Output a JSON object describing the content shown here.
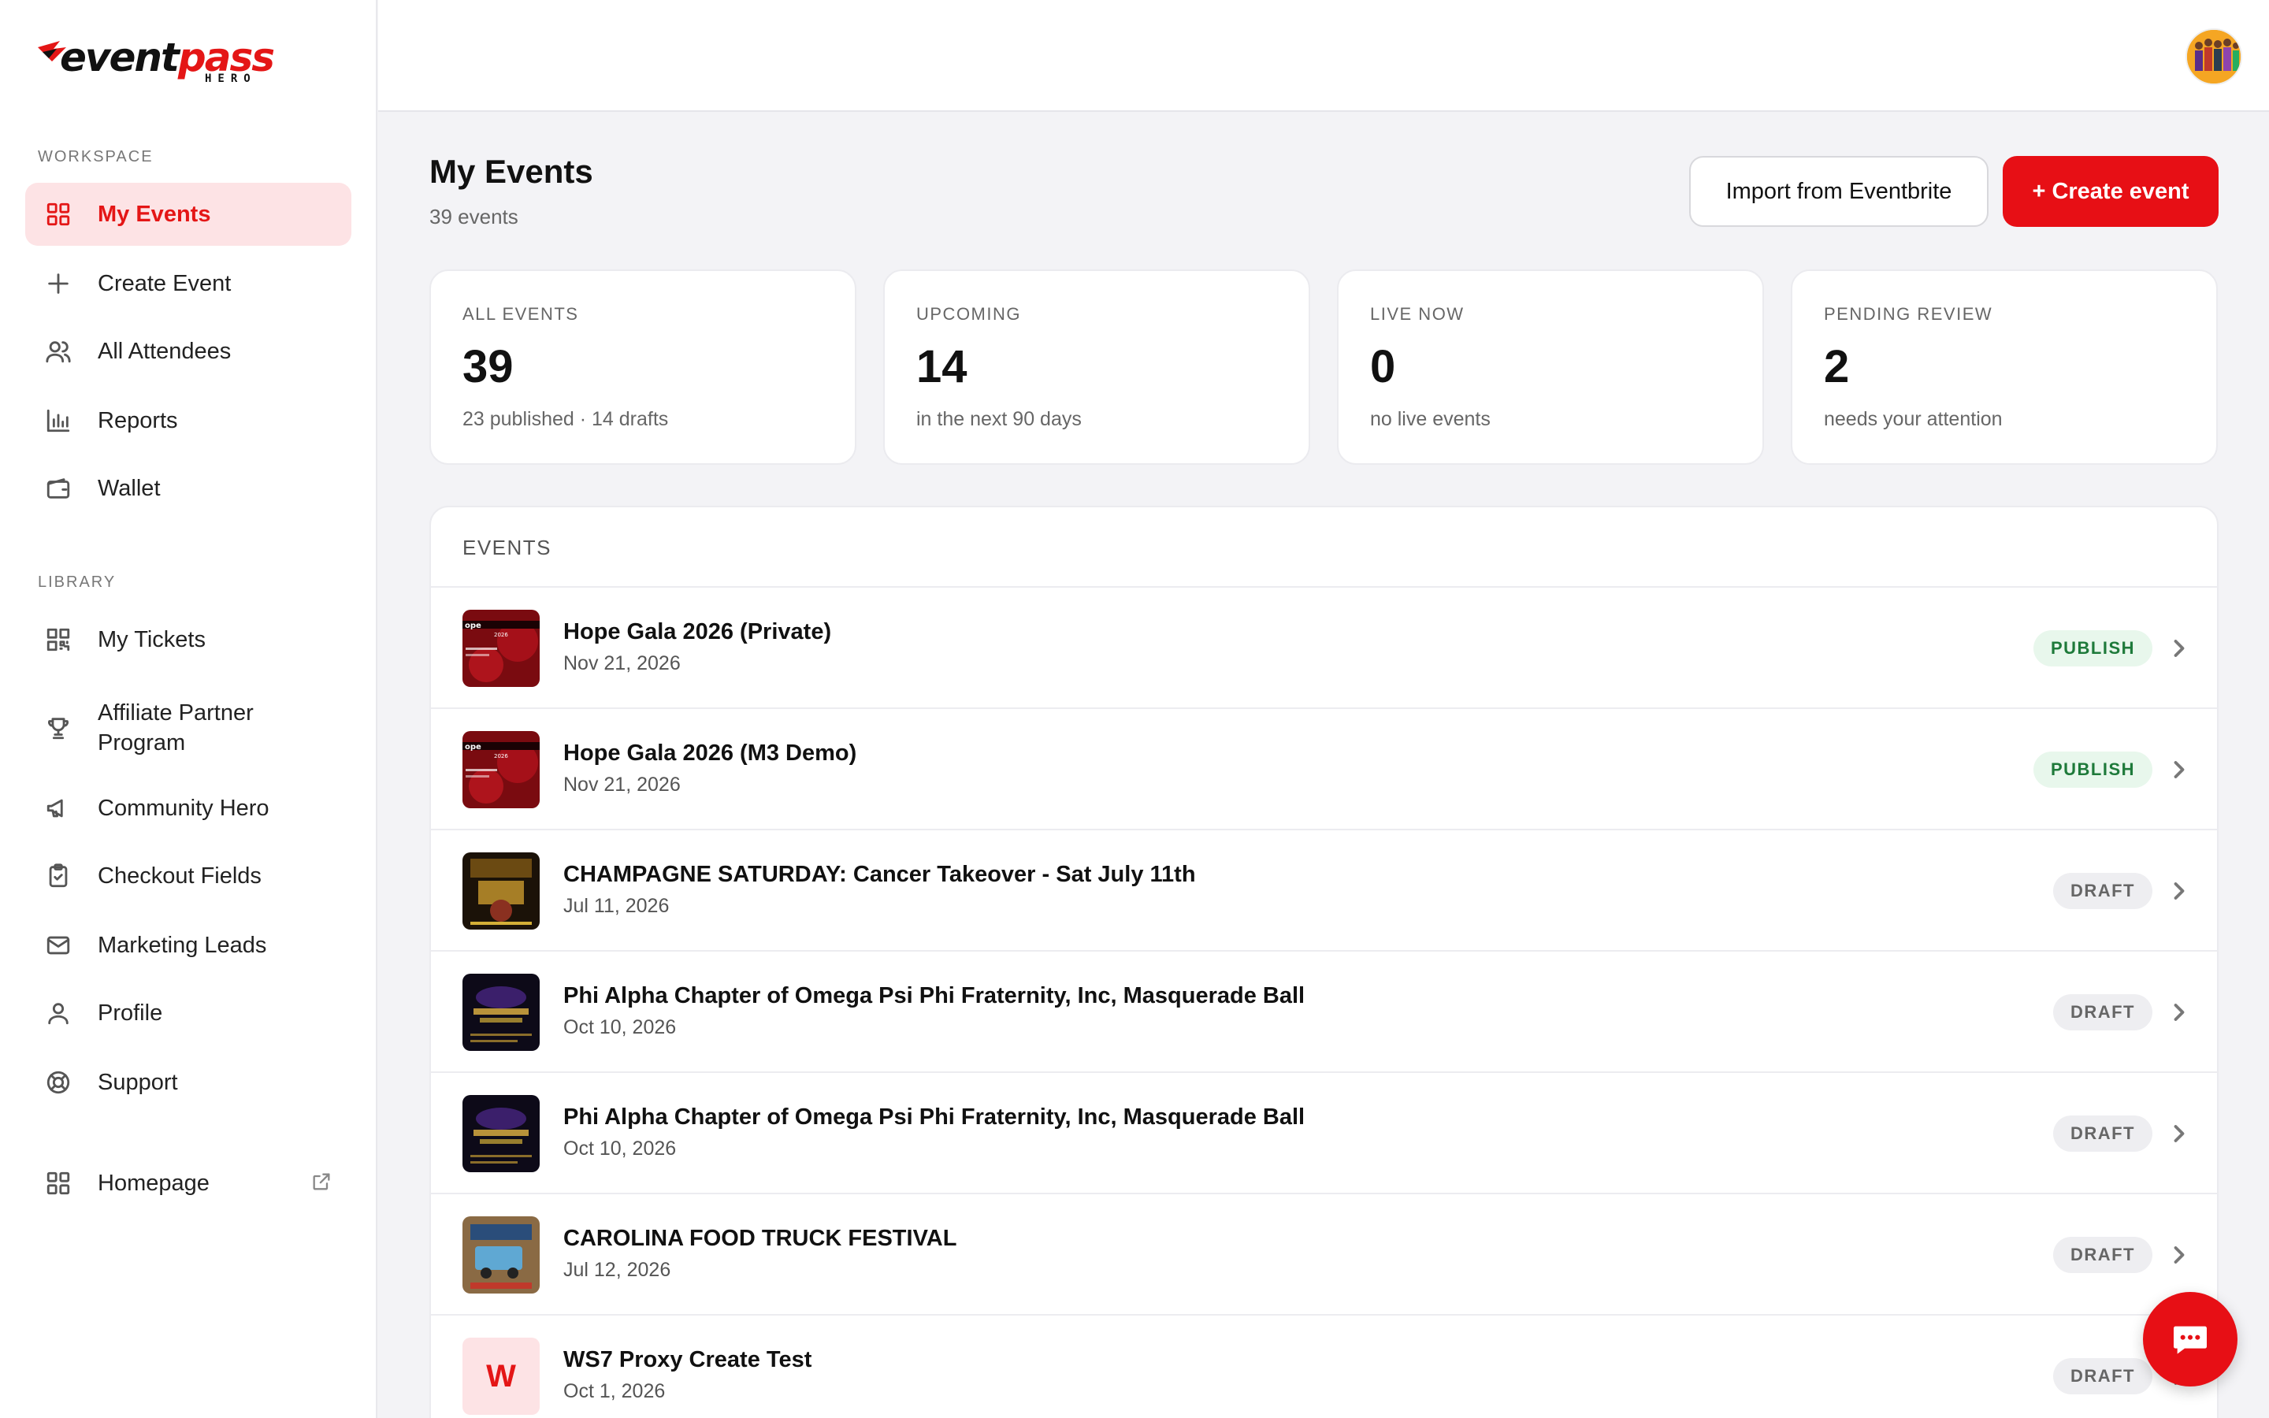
{
  "brand": {
    "name_part1": "event",
    "name_part2": "pass",
    "sub": "HERO",
    "accent": "#e70f15"
  },
  "sidebar": {
    "workspace_label": "WORKSPACE",
    "library_label": "LIBRARY",
    "workspace_items": [
      {
        "label": "My Events",
        "icon": "grid-icon",
        "active": true
      },
      {
        "label": "Create Event",
        "icon": "plus-icon"
      },
      {
        "label": "All Attendees",
        "icon": "users-icon"
      },
      {
        "label": "Reports",
        "icon": "bar-chart-icon"
      },
      {
        "label": "Wallet",
        "icon": "wallet-icon"
      }
    ],
    "library_items": [
      {
        "label": "My Tickets",
        "icon": "qr-code-icon"
      },
      {
        "label": "Affiliate Partner Program",
        "line1": "Affiliate Partner",
        "line2": "Program",
        "icon": "trophy-icon"
      },
      {
        "label": "Community Hero",
        "icon": "megaphone-icon"
      },
      {
        "label": "Checkout Fields",
        "icon": "clipboard-check-icon"
      },
      {
        "label": "Marketing Leads",
        "icon": "mail-icon"
      },
      {
        "label": "Profile",
        "icon": "user-icon"
      },
      {
        "label": "Support",
        "icon": "lifebuoy-icon"
      }
    ],
    "homepage": {
      "label": "Homepage",
      "icon": "grid-icon",
      "ext_icon": "external-link-icon"
    }
  },
  "header": {
    "title": "My Events",
    "subtitle": "39 events"
  },
  "actions": {
    "import_label": "Import from Eventbrite",
    "create_label": "+ Create event"
  },
  "stats": [
    {
      "label": "ALL EVENTS",
      "value": "39",
      "sub": "23 published · 14 drafts"
    },
    {
      "label": "UPCOMING",
      "value": "14",
      "sub": "in the next 90 days"
    },
    {
      "label": "LIVE NOW",
      "value": "0",
      "sub": "no live events"
    },
    {
      "label": "PENDING REVIEW",
      "value": "2",
      "sub": "needs your attention"
    }
  ],
  "events": {
    "header": "EVENTS",
    "rows": [
      {
        "title": "Hope Gala 2026 (Private)",
        "date": "Nov 21, 2026",
        "status": "PUBLISH",
        "thumb": "gala"
      },
      {
        "title": "Hope Gala 2026 (M3 Demo)",
        "date": "Nov 21, 2026",
        "status": "PUBLISH",
        "thumb": "gala"
      },
      {
        "title": "CHAMPAGNE SATURDAY: Cancer Takeover - Sat July 11th",
        "date": "Jul 11, 2026",
        "status": "DRAFT",
        "thumb": "champagne"
      },
      {
        "title": "Phi Alpha Chapter of Omega Psi Phi Fraternity, Inc, Masquerade Ball",
        "date": "Oct 10, 2026",
        "status": "DRAFT",
        "thumb": "masquerade"
      },
      {
        "title": "Phi Alpha Chapter of Omega Psi Phi Fraternity, Inc, Masquerade Ball",
        "date": "Oct 10, 2026",
        "status": "DRAFT",
        "thumb": "masquerade"
      },
      {
        "title": "CAROLINA FOOD TRUCK FESTIVAL",
        "date": "Jul 12, 2026",
        "status": "DRAFT",
        "thumb": "foodtruck"
      },
      {
        "title": "WS7 Proxy Create Test",
        "date": "Oct 1, 2026",
        "status": "DRAFT",
        "thumb": "letter",
        "letter": "W"
      }
    ]
  }
}
